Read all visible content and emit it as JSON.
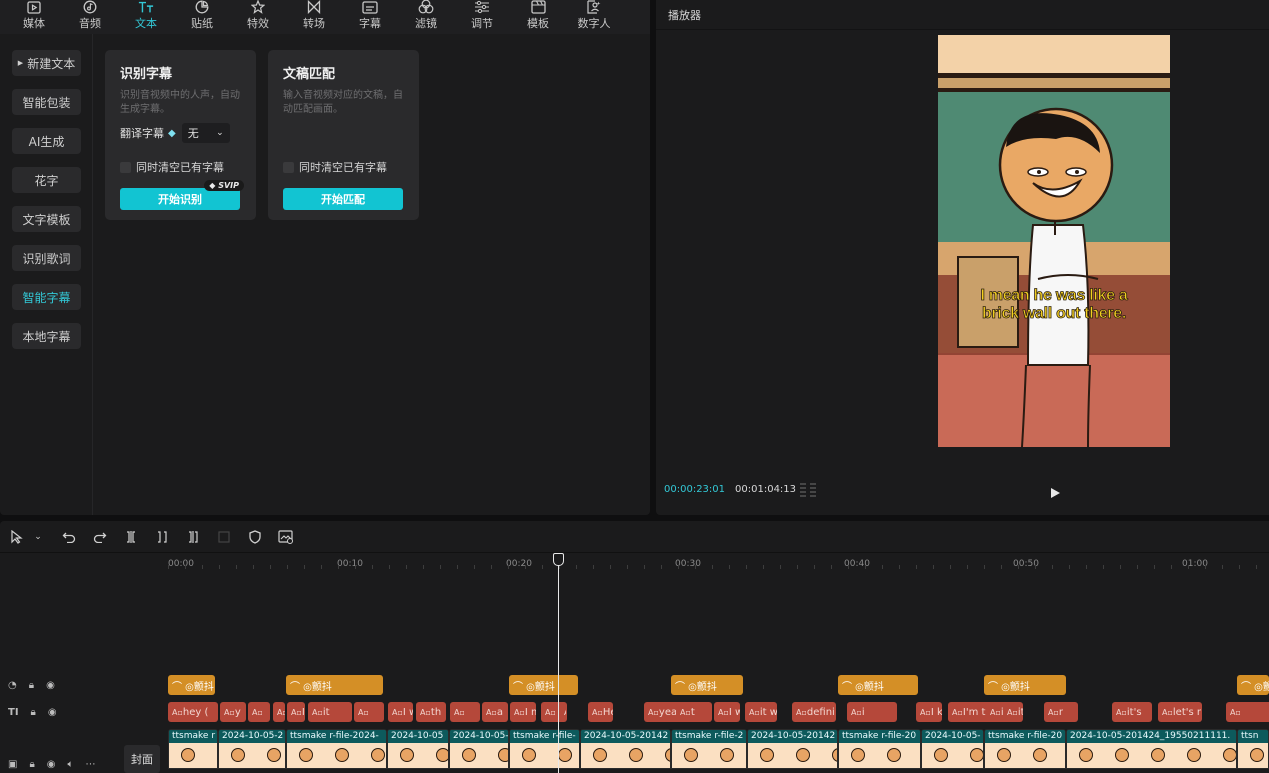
{
  "toolbar": {
    "items": [
      {
        "label": "媒体",
        "icon": "media-icon"
      },
      {
        "label": "音频",
        "icon": "audio-icon"
      },
      {
        "label": "文本",
        "icon": "text-icon"
      },
      {
        "label": "贴纸",
        "icon": "sticker-icon"
      },
      {
        "label": "特效",
        "icon": "effects-icon"
      },
      {
        "label": "转场",
        "icon": "transition-icon"
      },
      {
        "label": "字幕",
        "icon": "subtitle-icon"
      },
      {
        "label": "滤镜",
        "icon": "filter-icon"
      },
      {
        "label": "调节",
        "icon": "adjust-icon"
      },
      {
        "label": "模板",
        "icon": "template-icon"
      },
      {
        "label": "数字人",
        "icon": "digital-human-icon"
      }
    ],
    "active": "文本"
  },
  "sidebar": {
    "items": [
      {
        "label": "新建文本"
      },
      {
        "label": "智能包装"
      },
      {
        "label": "AI生成"
      },
      {
        "label": "花字"
      },
      {
        "label": "文字模板"
      },
      {
        "label": "识别歌词"
      },
      {
        "label": "智能字幕"
      },
      {
        "label": "本地字幕"
      }
    ],
    "selected": "智能字幕"
  },
  "cards": {
    "recognize": {
      "title": "识别字幕",
      "desc": "识别音视频中的人声，自动生成字幕。",
      "translate_label": "翻译字幕",
      "translate_value": "无",
      "clear_label": "同时清空已有字幕",
      "button": "开始识别",
      "badge": "SVIP"
    },
    "match": {
      "title": "文稿匹配",
      "desc": "输入音视频对应的文稿，自动匹配画面。",
      "clear_label": "同时清空已有字幕",
      "button": "开始匹配"
    }
  },
  "player": {
    "title": "播放器",
    "current_time": "00:00:23:01",
    "total_time": "00:01:04:13",
    "caption_line1": "I mean he was like a",
    "caption_line2": "brick wall out there."
  },
  "timeline": {
    "ruler": [
      "00:00",
      "00:10",
      "00:20",
      "00:30",
      "00:40",
      "00:50",
      "01:00"
    ],
    "cover_label": "封面",
    "effect_label": "颤抖",
    "text_clips": [
      "hey (",
      "y",
      "",
      "",
      "I coul",
      "it",
      "",
      "I w",
      "th",
      "",
      "a",
      "I m",
      "",
      "but y",
      "He",
      "yeah",
      "t",
      "I wa",
      "it wa",
      "defini",
      "i",
      "I know n",
      "I'm tel",
      "i",
      "it w",
      "r",
      "it's",
      "let's r",
      ""
    ],
    "video_clips": [
      "ttsmake r",
      "2024-10-05-2",
      "ttsmake r-file-2024-",
      "2024-10-05",
      "2024-10-05-",
      "ttsmake r-file-",
      "2024-10-05-20142",
      "ttsmake r-file-2",
      "2024-10-05-20142",
      "ttsmake r-file-20",
      "2024-10-05-",
      "ttsmake r-file-20",
      "2024-10-05-201424_19550211111.",
      "ttsn"
    ]
  },
  "colors": {
    "accent": "#33c8d6",
    "button": "#12c4d2",
    "effect_clip": "#d48f26",
    "text_clip": "#b5483a",
    "video_clip": "#0f6d6f"
  }
}
